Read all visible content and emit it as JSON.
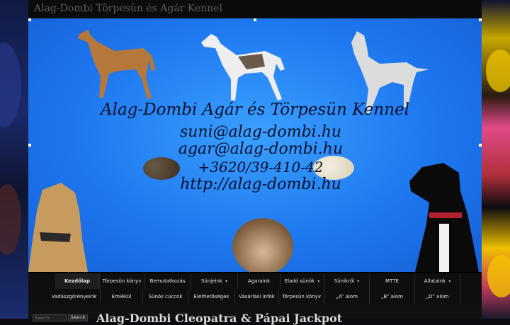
{
  "site": {
    "title": "Alag-Dombi Törpesün és Agár Kennel"
  },
  "banner": {
    "title": "Alag-Dombi Agár és Törpesün Kennel",
    "email1": "suni@alag-dombi.hu",
    "email2": "agar@alag-dombi.hu",
    "phone": "+3620/39-410-42",
    "url": "http://alag-dombi.hu"
  },
  "nav": {
    "row1": [
      {
        "label": "Kezdőlap",
        "active": true
      },
      {
        "label": "Törpesün könyv"
      },
      {
        "label": "Bemutatkozás"
      },
      {
        "label": "Sünjeink",
        "submenu": true
      },
      {
        "label": "Agaraink"
      },
      {
        "label": "Eladó sünök",
        "submenu": true
      },
      {
        "label": "Sünikről",
        "submenu": true
      },
      {
        "label": "MTTE"
      },
      {
        "label": "Állataink",
        "submenu": true
      }
    ],
    "row2": [
      {
        "label": "Vadászgörényeink"
      },
      {
        "label": "Emlékül"
      },
      {
        "label": "Sünös cuccok"
      },
      {
        "label": "Elérhetőségek"
      },
      {
        "label": "Vásárlási infók"
      },
      {
        "label": "Törpesün könyv"
      },
      {
        "label": "„A” alom"
      },
      {
        "label": "„B” alom"
      },
      {
        "label": "„D” alom"
      }
    ],
    "caret": "▾"
  },
  "search": {
    "placeholder": "Search",
    "button": "Search"
  },
  "post": {
    "title": "Alag-Dombi Cleopatra & Pápai Jackpot"
  },
  "colors": {
    "banner_blue": "#1e78f0",
    "background": "#000000",
    "nav_bg": "#0e0e0e"
  }
}
